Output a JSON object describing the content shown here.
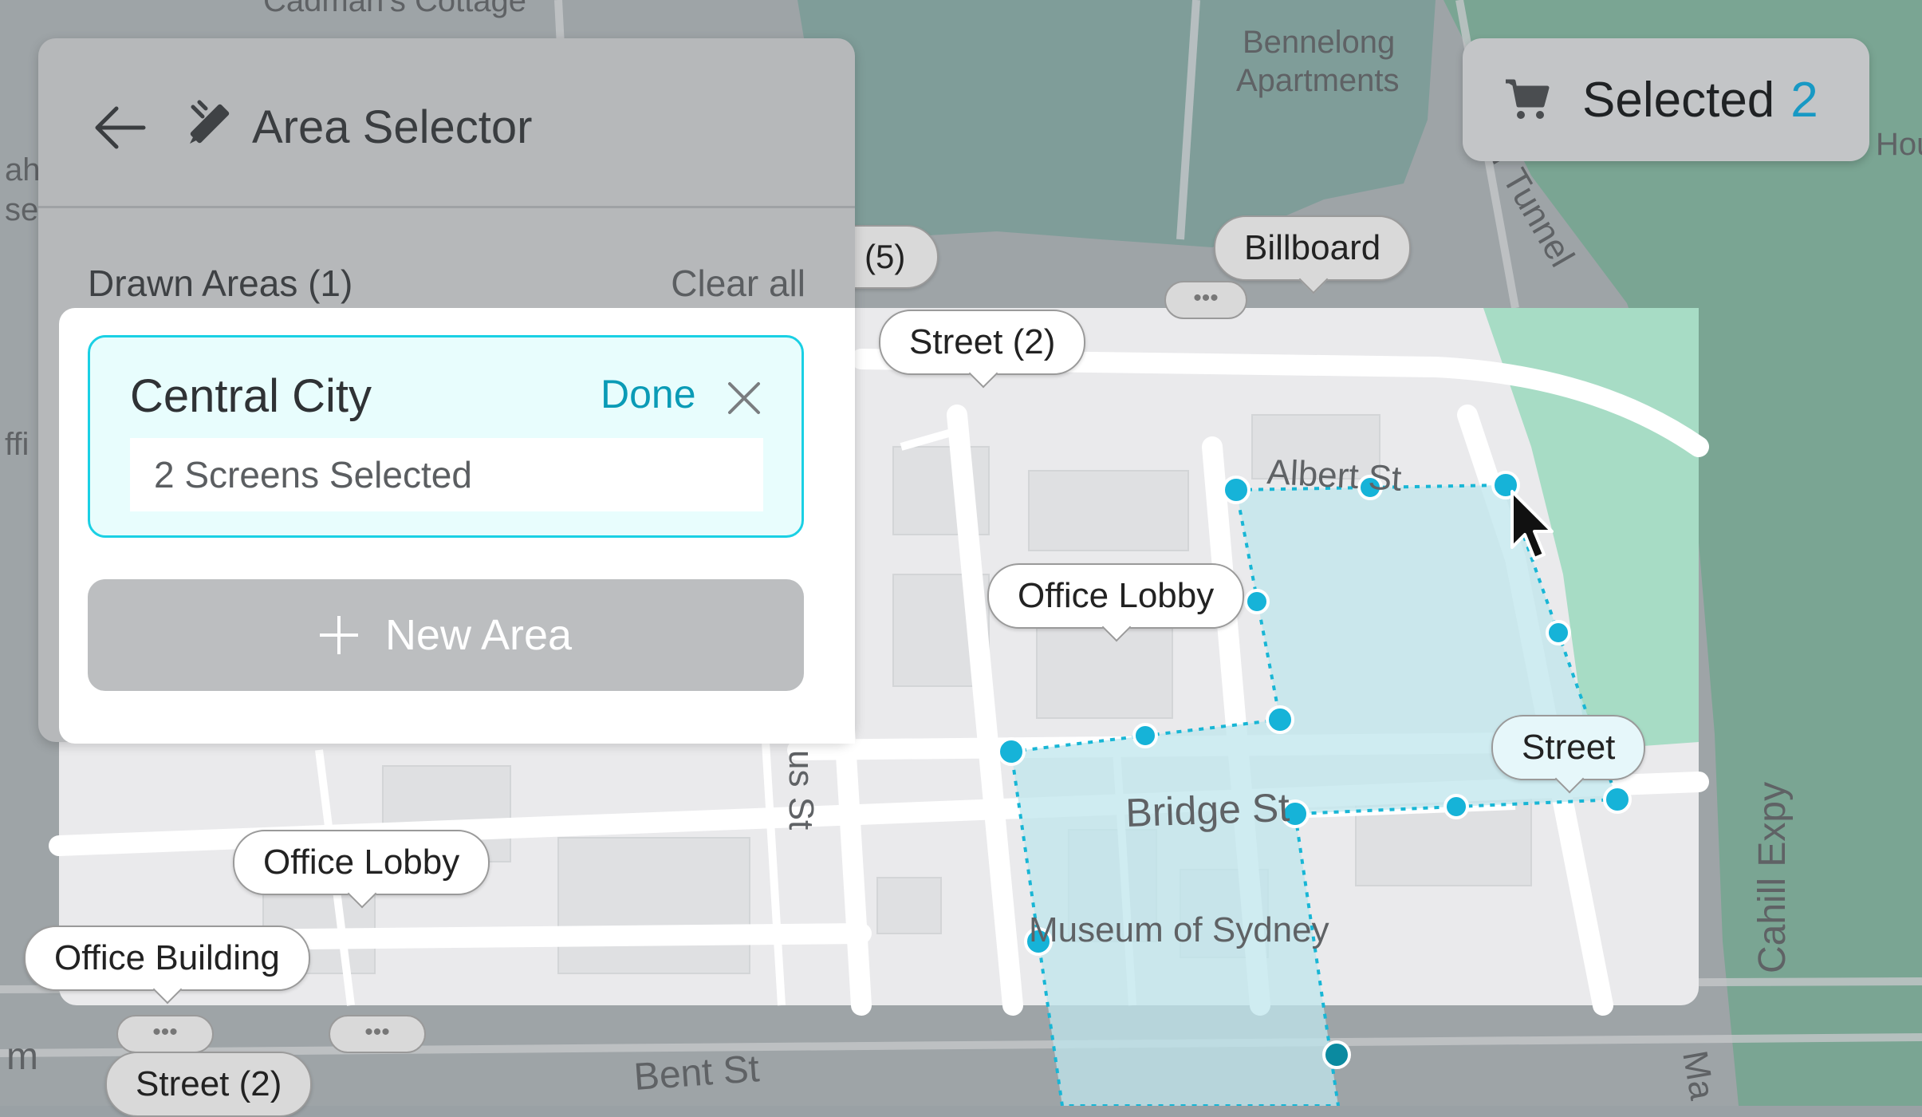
{
  "panel": {
    "title": "Area Selector",
    "drawn_areas_label": "Drawn Areas (1)",
    "clear_all_label": "Clear all"
  },
  "area": {
    "name": "Central City",
    "done_label": "Done",
    "count_text": "2 Screens Selected"
  },
  "new_area_label": "New Area",
  "selected": {
    "label": "Selected",
    "count": "2"
  },
  "map": {
    "streets": {
      "albert": "Albert St",
      "bridge": "Bridge St",
      "bent": "Bent St",
      "cahill": "Cahill Expy",
      "tunnel": "r Tunnel",
      "us_st": "us St",
      "museum": "Museum of Sydney",
      "bennelong_1": "Bennelong",
      "bennelong_2": "Apartments",
      "cadmans": "Cadman's Cottage",
      "ma": "Ma",
      "hou": "Hou",
      "left_ah": "ah",
      "left_se": "se",
      "left_ffi": "ffi",
      "left_m": "m"
    },
    "pins": {
      "street_5": "(5)",
      "billboard": "Billboard",
      "street_2_top": "Street (2)",
      "office_lobby_center": "Office Lobby",
      "street_right": "Street",
      "office_lobby_left": "Office Lobby",
      "office_building": "Office Building",
      "street_2_bottom": "Street (2)"
    },
    "dots": "•••"
  },
  "colors": {
    "accent": "#1ad0e4",
    "accent_dark": "#0a9bb6",
    "count_blue": "#1899c4",
    "selection_fill": "#bfe7ee",
    "water": "#8fb2ad",
    "park": "#a8d8c4"
  },
  "icons": [
    "back-arrow-icon",
    "pencil-ruler-icon",
    "close-icon",
    "plus-icon",
    "cart-icon",
    "mouse-cursor-icon"
  ]
}
